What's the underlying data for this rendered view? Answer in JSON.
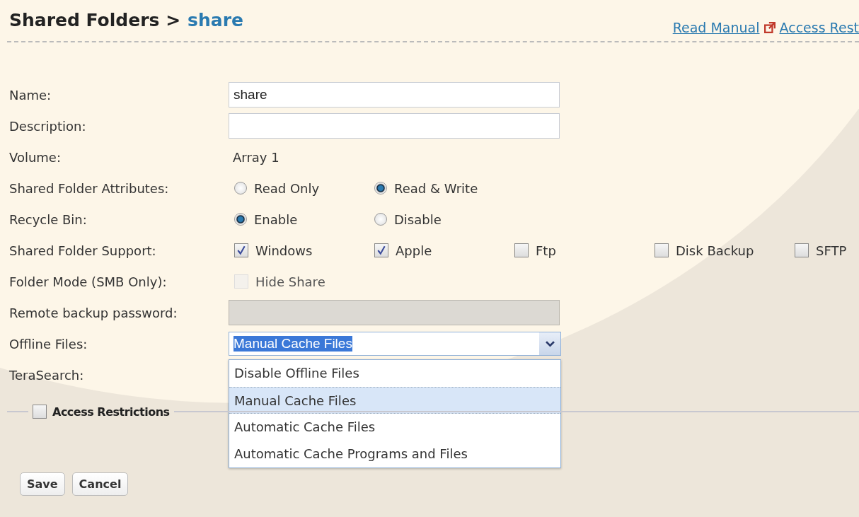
{
  "header": {
    "title": "Shared Folders >",
    "current": "share",
    "links": [
      {
        "label": "Read Manual",
        "external": true
      },
      {
        "label": "Access Rest",
        "external": false
      }
    ]
  },
  "fields": [
    {
      "kind": "text",
      "label": "Name:",
      "value": "share",
      "disabled": false
    },
    {
      "kind": "text",
      "label": "Description:",
      "disabled": false
    },
    {
      "kind": "static",
      "label": "Volume:",
      "value": "Array 1"
    },
    {
      "kind": "radio",
      "label": "Shared Folder Attributes:",
      "options": [
        {
          "label": "Read Only",
          "selected": false
        },
        {
          "label": "Read & Write",
          "selected": true
        }
      ]
    },
    {
      "kind": "radio",
      "label": "Recycle Bin:",
      "options": [
        {
          "label": "Enable",
          "selected": true
        },
        {
          "label": "Disable",
          "selected": false
        }
      ]
    },
    {
      "kind": "checkbox",
      "label": "Shared Folder Support:",
      "options": [
        {
          "label": "Windows",
          "checked": true,
          "disabled": false
        },
        {
          "label": "Apple",
          "checked": true,
          "disabled": false
        },
        {
          "label": "Ftp",
          "checked": false,
          "disabled": false
        },
        {
          "label": "Disk Backup",
          "checked": false,
          "disabled": false
        },
        {
          "label": "SFTP",
          "checked": false,
          "disabled": false
        }
      ]
    },
    {
      "kind": "checkbox",
      "label": "Folder Mode (SMB Only):",
      "options": [
        {
          "label": "Hide Share",
          "checked": false,
          "disabled": true
        }
      ]
    },
    {
      "kind": "text",
      "label": "Remote backup password:",
      "disabled": true
    },
    {
      "kind": "select",
      "label": "Offline Files:",
      "value": "Manual Cache Files",
      "expanded": true,
      "options": [
        {
          "label": "Disable Offline Files",
          "selected": false
        },
        {
          "label": "Manual Cache Files",
          "selected": true
        },
        {
          "label": "Automatic Cache Files",
          "selected": false
        },
        {
          "label": "Automatic Cache Programs and Files",
          "selected": false
        }
      ]
    },
    {
      "kind": "static",
      "label": "TeraSearch:"
    }
  ],
  "section": {
    "label": "Access Restrictions",
    "checked": false
  },
  "buttons": [
    "Save",
    "Cancel"
  ]
}
